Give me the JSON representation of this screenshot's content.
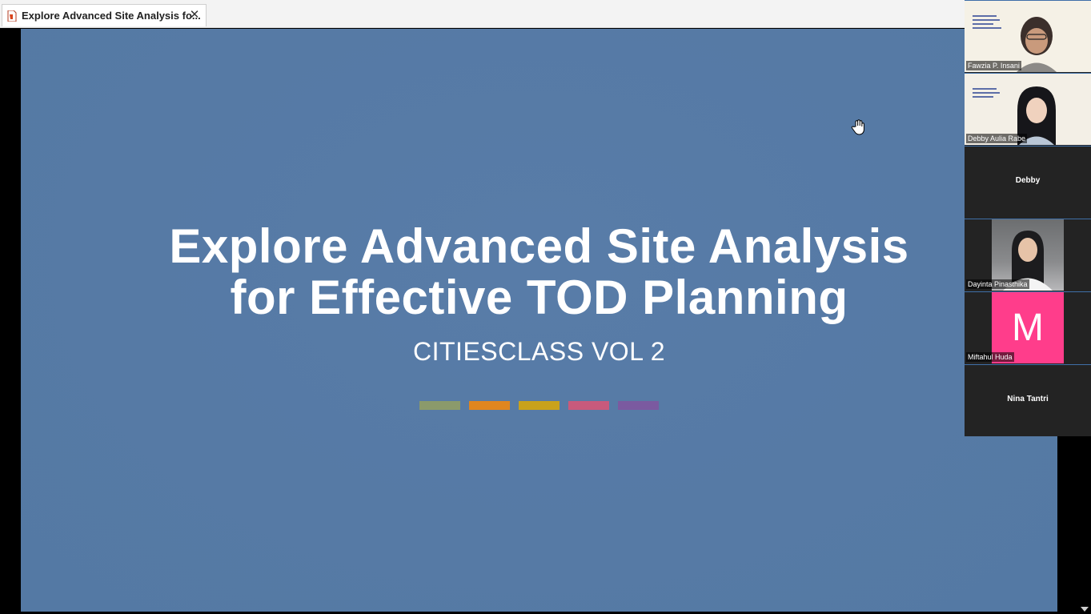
{
  "tab": {
    "title": "Explore Advanced Site Analysis fo...",
    "close_label": "✕",
    "file_icon": "pdf-file-icon"
  },
  "slide": {
    "title_line1": "Explore Advanced Site Analysis",
    "title_line2": "for Effective TOD Planning",
    "subtitle": "CITIESCLASS VOL 2",
    "bar_colors": [
      "#8b9a6b",
      "#e0861f",
      "#c9a21b",
      "#c85a7c",
      "#7b5aa0"
    ],
    "background": "#5779a5"
  },
  "participants": [
    {
      "name": "Fawzia P. Insani",
      "type": "video"
    },
    {
      "name": "Debby Aulia Rabe",
      "type": "video"
    },
    {
      "name": "Debby",
      "type": "no-video"
    },
    {
      "name": "Dayinta Pinasthika",
      "type": "photo"
    },
    {
      "name": "Miftahul Huda",
      "type": "avatar",
      "initial": "M",
      "color": "#ff3d8b"
    },
    {
      "name": "Nina Tantri",
      "type": "no-video"
    }
  ],
  "cursor_icon": "hand-cursor-icon"
}
